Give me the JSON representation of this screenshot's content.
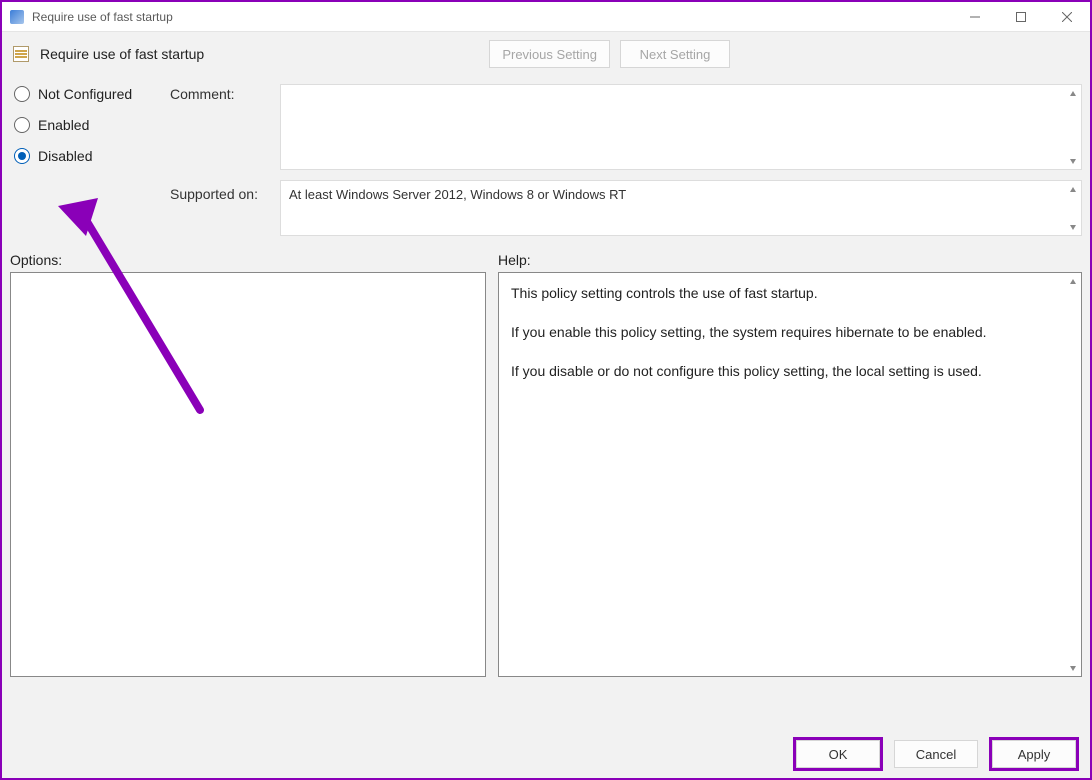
{
  "window": {
    "title": "Require use of fast startup"
  },
  "header": {
    "setting_name": "Require use of fast startup",
    "prev": "Previous Setting",
    "next": "Next Setting"
  },
  "radios": {
    "not_configured": "Not Configured",
    "enabled": "Enabled",
    "disabled": "Disabled",
    "selected": "disabled"
  },
  "labels": {
    "comment": "Comment:",
    "supported": "Supported on:",
    "options": "Options:",
    "help": "Help:"
  },
  "fields": {
    "comment": "",
    "supported": "At least Windows Server 2012, Windows 8 or Windows RT"
  },
  "help": {
    "p1": "This policy setting controls the use of fast startup.",
    "p2": "If you enable this policy setting, the system requires hibernate to be enabled.",
    "p3": "If you disable or do not configure this policy setting, the local setting is used."
  },
  "buttons": {
    "ok": "OK",
    "cancel": "Cancel",
    "apply": "Apply"
  }
}
